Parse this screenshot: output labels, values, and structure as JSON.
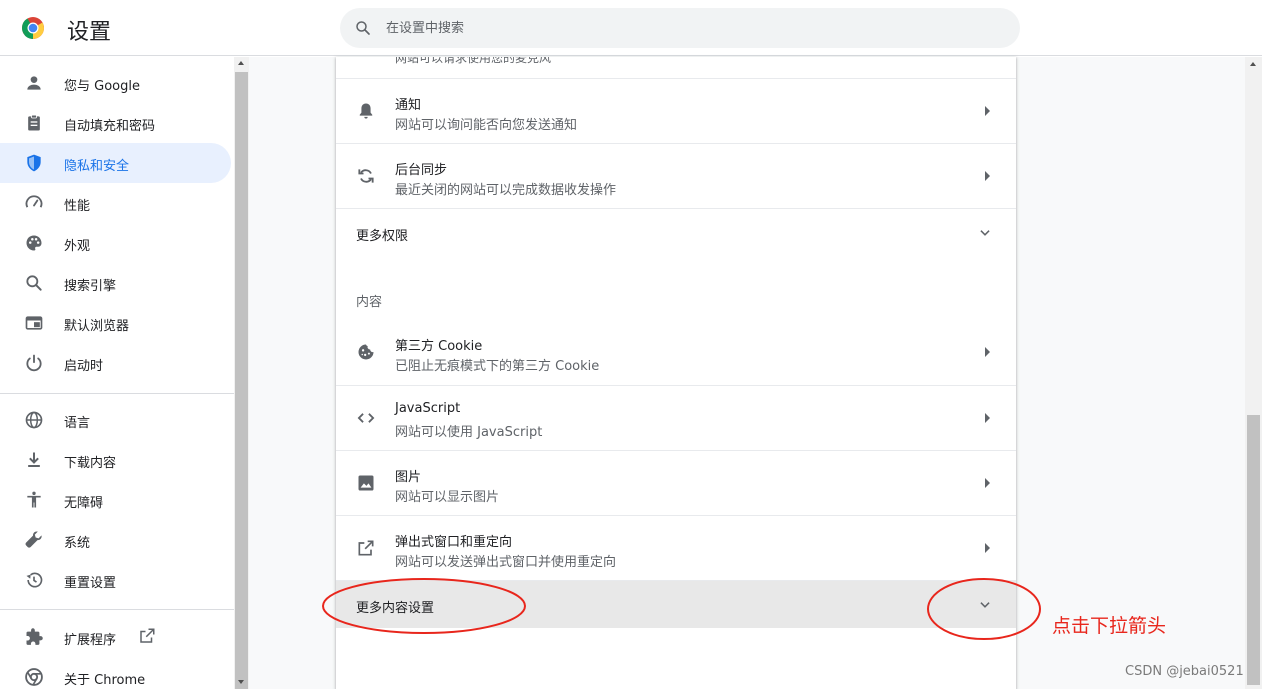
{
  "header": {
    "title": "设置",
    "search_placeholder": "在设置中搜索",
    "logo_icon": "chrome-logo-icon",
    "search_icon": "search-icon"
  },
  "sidebar": {
    "items": [
      {
        "label": "您与 Google",
        "icon": "person-icon"
      },
      {
        "label": "自动填充和密码",
        "icon": "clipboard-icon"
      },
      {
        "label": "隐私和安全",
        "icon": "shield-icon",
        "active": true
      },
      {
        "label": "性能",
        "icon": "speedometer-icon"
      },
      {
        "label": "外观",
        "icon": "palette-icon"
      },
      {
        "label": "搜索引擎",
        "icon": "search-icon"
      },
      {
        "label": "默认浏览器",
        "icon": "browser-window-icon"
      },
      {
        "label": "启动时",
        "icon": "power-icon"
      },
      {
        "label": "语言",
        "icon": "globe-icon"
      },
      {
        "label": "下载内容",
        "icon": "download-icon"
      },
      {
        "label": "无障碍",
        "icon": "accessibility-icon"
      },
      {
        "label": "系统",
        "icon": "wrench-icon"
      },
      {
        "label": "重置设置",
        "icon": "history-icon"
      },
      {
        "label": "扩展程序",
        "icon": "puzzle-icon"
      },
      {
        "label": "关于 Chrome",
        "icon": "chrome-icon"
      }
    ]
  },
  "main": {
    "cut_off_text": "网站可以请求使用您的麦克风",
    "permissions": [
      {
        "title": "通知",
        "subtitle": "网站可以询问能否向您发送通知",
        "icon": "bell-icon"
      },
      {
        "title": "后台同步",
        "subtitle": "最近关闭的网站可以完成数据收发操作",
        "icon": "sync-icon"
      }
    ],
    "more_permissions_label": "更多权限",
    "content_section_title": "内容",
    "content_items": [
      {
        "title": "第三方 Cookie",
        "subtitle": "已阻止无痕模式下的第三方 Cookie",
        "icon": "cookie-icon"
      },
      {
        "title": "JavaScript",
        "subtitle": "网站可以使用 JavaScript",
        "icon": "code-icon"
      },
      {
        "title": "图片",
        "subtitle": "网站可以显示图片",
        "icon": "image-icon"
      },
      {
        "title": "弹出式窗口和重定向",
        "subtitle": "网站可以发送弹出式窗口并使用重定向",
        "icon": "open-in-new-icon"
      }
    ],
    "more_content_settings_label": "更多内容设置"
  },
  "annotation": {
    "label": "点击下拉箭头",
    "color": "#e8261c"
  },
  "watermark": "CSDN @jebai0521",
  "colors": {
    "accent": "#1a73e8",
    "active_bg": "#e8f0fe",
    "icon": "#5f6368"
  }
}
